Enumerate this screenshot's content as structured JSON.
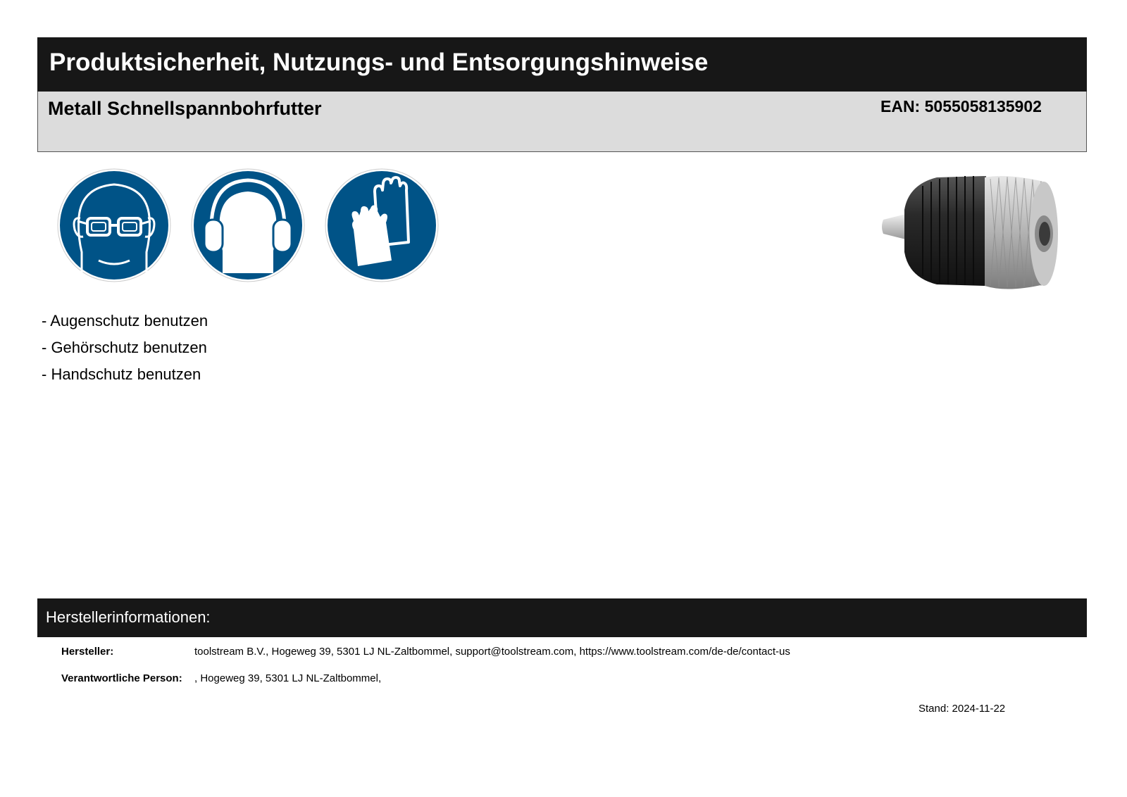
{
  "header": {
    "title": "Produktsicherheit, Nutzungs- und Entsorgungshinweise",
    "product_name": "Metall Schnellspannbohrfutter",
    "ean": "EAN: 5055058135902"
  },
  "pictograms": [
    {
      "icon": "eye-protection-icon"
    },
    {
      "icon": "hearing-protection-icon"
    },
    {
      "icon": "hand-protection-icon"
    }
  ],
  "colors": {
    "pictogram_blue": "#005387",
    "header_black": "#171717",
    "subheader_grey": "#dcdcdc"
  },
  "hints": [
    "- Augenschutz benutzen",
    "- Gehörschutz benutzen",
    "- Handschutz benutzen"
  ],
  "manufacturer": {
    "section_title": "Herstellerinformationen:",
    "manufacturer_label": "Hersteller:",
    "manufacturer_value": "toolstream B.V., Hogeweg 39, 5301 LJ NL-Zaltbommel, support@toolstream.com, https://www.toolstream.com/de-de/contact-us",
    "responsible_label": "Verantwortliche Person:",
    "responsible_value": ", Hogeweg 39, 5301 LJ NL-Zaltbommel,"
  },
  "stand": "Stand: 2024-11-22"
}
